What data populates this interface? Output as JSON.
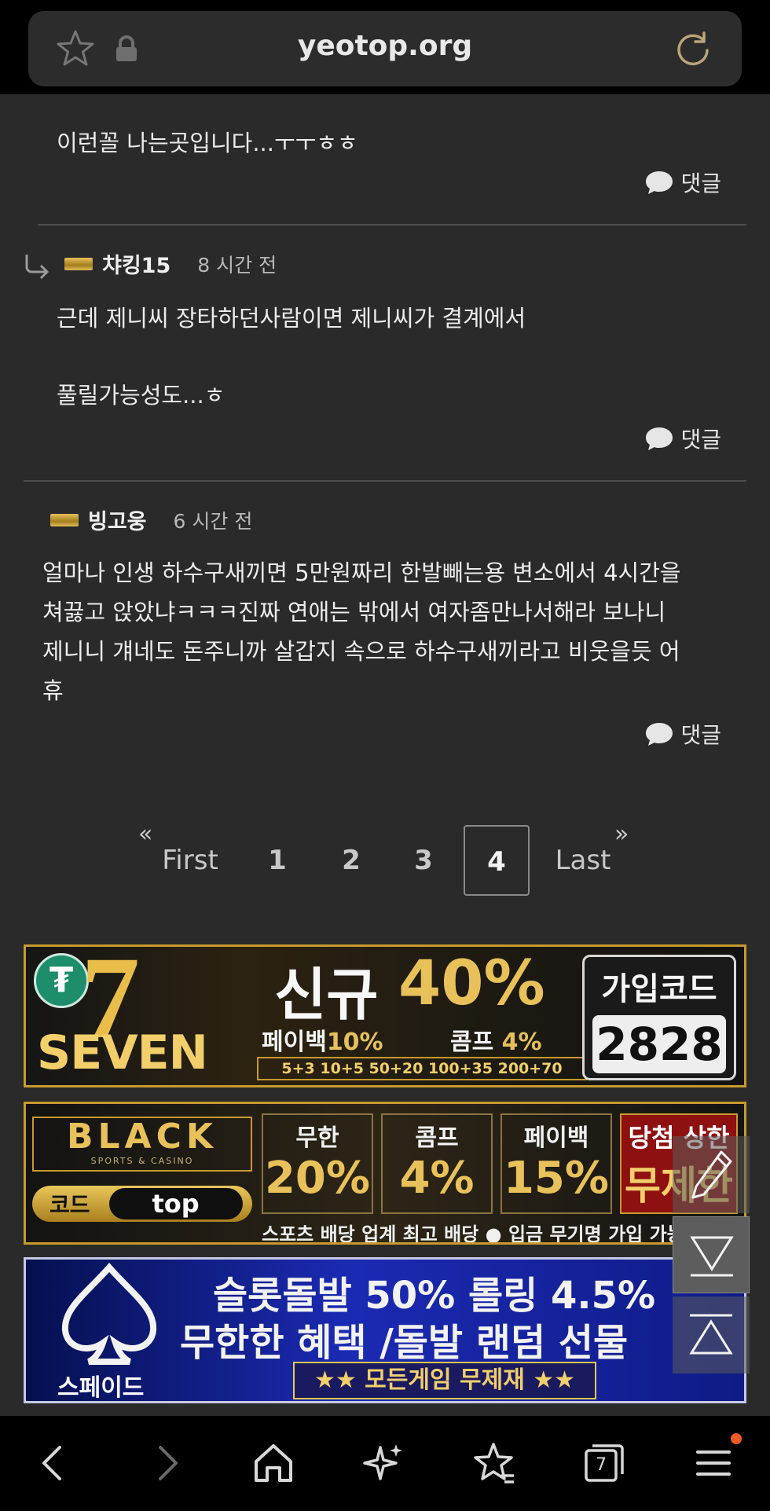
{
  "browser": {
    "url": "yeotop.org",
    "icons": [
      "star-icon",
      "lock-icon",
      "reload-icon"
    ]
  },
  "comments": [
    {
      "text": "이런꼴 나는곳입니다...ㅜㅜㅎㅎ",
      "reply_label": "댓글"
    },
    {
      "author": "챠킹15",
      "time": "8 시간 전",
      "line1": "근데 제니씨 장타하던사람이면 제니씨가 결계에서",
      "line2": "풀릴가능성도...ㅎ",
      "reply_label": "댓글"
    },
    {
      "author": "빙고웅",
      "time": "6 시간 전",
      "lines": [
        "얼마나 인생 하수구새끼면 5만원짜리 한발빼는용 변소에서 4시간을",
        "쳐끓고 앉았냐ㅋㅋㅋ진짜 연애는 밖에서 여자좀만나서해라 보나니",
        "제니니 걔네도 돈주니까 살갑지 속으로 하수구새끼라고 비웃을듯 어",
        "휴"
      ],
      "reply_label": "댓글"
    }
  ],
  "pagination": {
    "first": "First",
    "last": "Last",
    "first_arrow": "«",
    "last_arrow": "»",
    "pages": [
      "1",
      "2",
      "3",
      "4"
    ],
    "current": "4"
  },
  "ads": {
    "ad1": {
      "brand": "SEVEN",
      "big_digit": "7",
      "headline_a": "신규",
      "headline_b": "40%",
      "payback_label": "페이백",
      "payback_value": "10%",
      "comp_label": "콤프",
      "comp_value": "4%",
      "bonus_tiers": "5+3 10+5 50+20 100+35 200+70",
      "code_label": "가입코드",
      "code_value": "2828"
    },
    "ad2": {
      "brand": "BLACK",
      "brand_sub": "SPORTS & CASINO",
      "code_label": "코드",
      "code_value": "top",
      "boxes": [
        {
          "label": "무한",
          "value": "20%"
        },
        {
          "label": "콤프",
          "value": "4%"
        },
        {
          "label": "페이백",
          "value": "15%"
        }
      ],
      "jackpot_label": "당첨 상한",
      "jackpot_value": "무제한",
      "ticker": "스포츠 배당 업계 최고 배당 ● 입금 무기명 가입 가능"
    },
    "ad3": {
      "brand": "스페이드",
      "line1": "슬롯돌발 50% 롤링 4.5%",
      "line2": "무한한 혜택 /돌발 랜덤 선물",
      "line3": "★★ 모든게임 무제재 ★★"
    }
  },
  "bottom_nav": {
    "tabs_count": "7",
    "icons": [
      "back-icon",
      "forward-icon",
      "home-icon",
      "sparkle-icon",
      "bookmark-star-icon",
      "tabs-icon",
      "menu-icon"
    ]
  }
}
